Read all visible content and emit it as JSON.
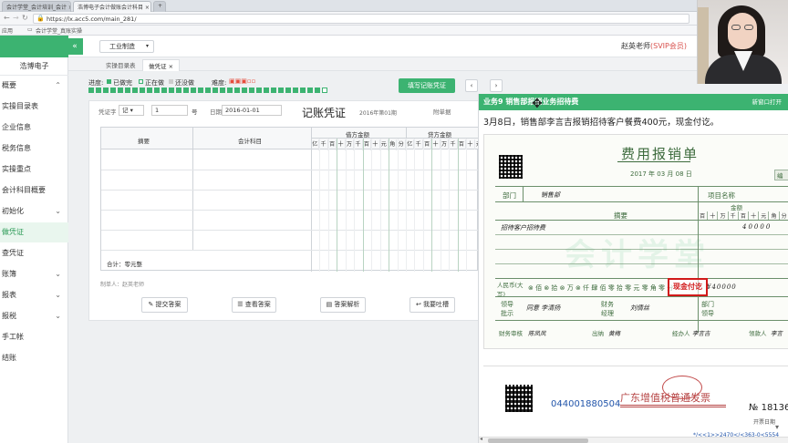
{
  "browser": {
    "tabs": [
      "会计学堂_会计培训_会计",
      "浩博电子会计做账会计科目",
      "+"
    ],
    "url": "https://lx.acc5.com/main_281/",
    "bookmarks": [
      "应用",
      "会计学堂_真账实操"
    ]
  },
  "sidebar": {
    "company": "浩博电子",
    "items": [
      {
        "label": "概要",
        "expand": true
      },
      {
        "label": "实操目录表",
        "expand": false
      },
      {
        "label": "企业信息",
        "expand": false
      },
      {
        "label": "税务信息",
        "expand": false
      },
      {
        "label": "实操重点",
        "expand": false
      },
      {
        "label": "会计科目概要",
        "expand": false
      },
      {
        "label": "初始化",
        "expand": true
      },
      {
        "label": "做凭证",
        "expand": false
      },
      {
        "label": "查凭证",
        "expand": false
      },
      {
        "label": "账簿",
        "expand": true
      },
      {
        "label": "报表",
        "expand": true
      },
      {
        "label": "报税",
        "expand": true
      },
      {
        "label": "手工帐",
        "expand": false
      },
      {
        "label": "结账",
        "expand": false
      }
    ]
  },
  "topbar": {
    "industry": "工业制造",
    "user": "赵英老师",
    "vip": "(SVIP会员)"
  },
  "subtabs": [
    "实操目录表",
    "做凭证"
  ],
  "progress": {
    "label": "进度:",
    "done": "已做完",
    "doing": "正在做",
    "todo": "还没做",
    "difficulty": "难度:",
    "fill_btn": "填写记账凭证"
  },
  "voucher": {
    "word_label": "凭证字",
    "word_value": "记",
    "num_value": "1",
    "num_unit": "号",
    "date_label": "日期",
    "date_value": "2016-01-01",
    "title": "记账凭证",
    "period": "2016年第01期",
    "attach_label": "附单据",
    "col_summary": "摘要",
    "col_account": "会计科目",
    "col_debit": "借方金额",
    "col_credit": "贷方金额",
    "digits": [
      "亿",
      "千",
      "百",
      "十",
      "万",
      "千",
      "百",
      "十",
      "元",
      "角",
      "分"
    ],
    "total_label": "合计：零元整",
    "maker": "制单人：赵英老师"
  },
  "actions": {
    "submit": "提交答案",
    "view": "查看答案",
    "explain": "答案解析",
    "feedback": "我要吐槽"
  },
  "panel": {
    "task": "业务9 销售部报销业务招待费",
    "new_window": "新窗口打开",
    "desc": "3月8日，销售部李言吉报销招待客户餐费400元，现金付讫。",
    "form_title": "费用报销单",
    "form_date": "2017 年 03 月 08 日",
    "dept_label": "部门",
    "dept_value": "销售部",
    "project_label": "项目名称",
    "summary_label": "摘要",
    "amount_label": "金额",
    "amount_digits": [
      "百",
      "十",
      "万",
      "千",
      "百",
      "十",
      "元",
      "角",
      "分"
    ],
    "line1": "招待客户招待费",
    "amount_value": "40000",
    "total_label": "人民币(大写)",
    "total_text": "⊗ 佰 ⊗ 拾 ⊗ 万 ⊗ 仟 肆 佰 零 拾 零 元 零 角 零 分",
    "total_value": "¥40000",
    "stamp": "现金付讫",
    "lead_label": "领导批示",
    "lead_value": "同意 李清扬",
    "fin_label": "财务经理",
    "fin_value": "刘倩丝",
    "dept_mgr_label": "部门领导",
    "audit_label": "财务审核",
    "audit_value": "陈凤凤",
    "cashier_label": "出纳",
    "cashier_value": "黄梅",
    "handler_label": "经办人",
    "handler_value": "李言吉",
    "receiver_label": "领款人",
    "receiver_value": "李言",
    "attach_label": "附",
    "invoice_title": "广东增值税普通发票",
    "invoice_code": "044001880504",
    "invoice_no": "№ 181360",
    "invoice_date_label": "开票日期",
    "invoice_cipher": "*/<<1>>2470</<363-0<5554",
    "watermark": "会计学堂"
  },
  "colors": {
    "accent": "#3cb371",
    "red": "#c62828",
    "form_green": "#6b8f6b"
  }
}
